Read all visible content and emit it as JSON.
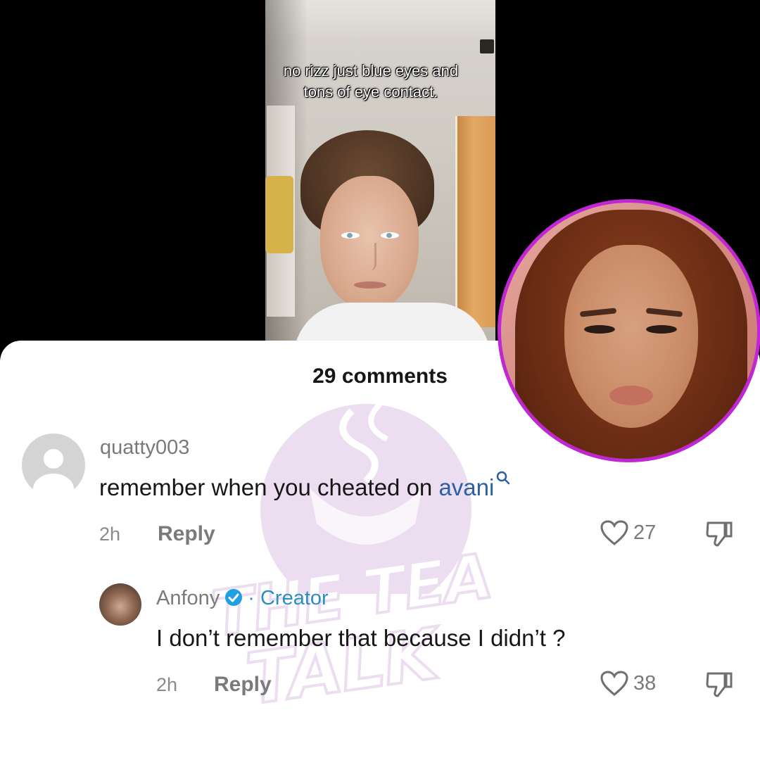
{
  "video": {
    "caption_line1": "no rizz just blue eyes and",
    "caption_line2": "tons of eye contact."
  },
  "comments_header": "29 comments",
  "watermark": {
    "line1": "THE TEA",
    "line2": "TALK"
  },
  "comments": [
    {
      "username": "quatty003",
      "text_prefix": "remember when you cheated on ",
      "mention": "avani",
      "time": "2h",
      "reply_label": "Reply",
      "likes": "27"
    },
    {
      "username": "Anfony",
      "creator_separator": "·",
      "creator_label": "Creator",
      "text": "I don’t remember that because I didn’t ?",
      "time": "2h",
      "reply_label": "Reply",
      "likes": "38"
    }
  ],
  "colors": {
    "overlay_border": "#c026d3",
    "mention": "#2b5fa6",
    "creator": "#2a8fbf",
    "verified": "#20a0e0"
  },
  "icons": [
    "default-avatar-icon",
    "search-icon",
    "verified-icon",
    "heart-icon",
    "dislike-icon"
  ]
}
